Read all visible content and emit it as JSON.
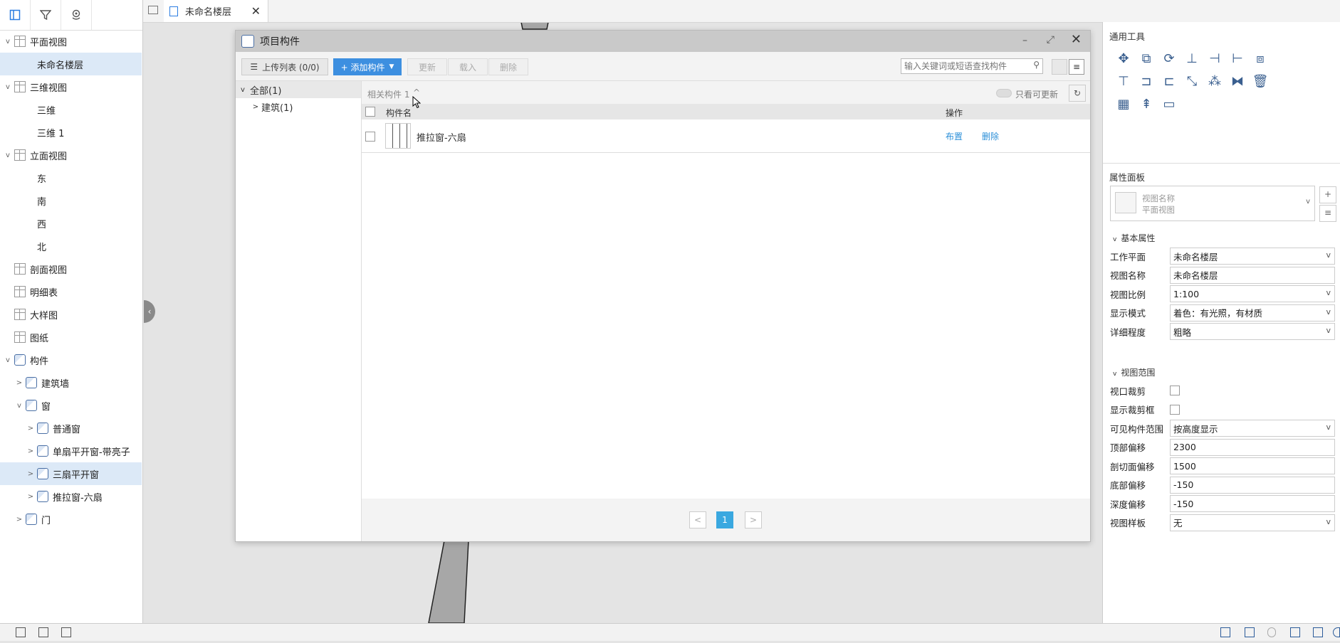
{
  "tab": {
    "title": "未命名楼层"
  },
  "tree": [
    {
      "label": "平面视图",
      "level": 0,
      "arrow": "v",
      "icon": "view"
    },
    {
      "label": "未命名楼层",
      "level": 1,
      "arrow": "",
      "icon": "",
      "selected": true
    },
    {
      "label": "三维视图",
      "level": 0,
      "arrow": "v",
      "icon": "view"
    },
    {
      "label": "三维",
      "level": 1,
      "arrow": "",
      "icon": ""
    },
    {
      "label": "三维 1",
      "level": 1,
      "arrow": "",
      "icon": ""
    },
    {
      "label": "立面视图",
      "level": 0,
      "arrow": "v",
      "icon": "view"
    },
    {
      "label": "东",
      "level": 1,
      "arrow": "",
      "icon": ""
    },
    {
      "label": "南",
      "level": 1,
      "arrow": "",
      "icon": ""
    },
    {
      "label": "西",
      "level": 1,
      "arrow": "",
      "icon": ""
    },
    {
      "label": "北",
      "level": 1,
      "arrow": "",
      "icon": ""
    },
    {
      "label": "剖面视图",
      "level": 0,
      "arrow": "",
      "icon": "view"
    },
    {
      "label": "明细表",
      "level": 0,
      "arrow": "",
      "icon": "view"
    },
    {
      "label": "大样图",
      "level": 0,
      "arrow": "",
      "icon": "view"
    },
    {
      "label": "图纸",
      "level": 0,
      "arrow": "",
      "icon": "view"
    },
    {
      "label": "构件",
      "level": 0,
      "arrow": "v",
      "icon": "comp"
    },
    {
      "label": "建筑墙",
      "level": 1,
      "arrow": ">",
      "icon": "comp"
    },
    {
      "label": "窗",
      "level": 1,
      "arrow": "v",
      "icon": "comp"
    },
    {
      "label": "普通窗",
      "level": 2,
      "arrow": ">",
      "icon": "comp"
    },
    {
      "label": "单扇平开窗-带亮子",
      "level": 2,
      "arrow": ">",
      "icon": "comp"
    },
    {
      "label": "三扇平开窗",
      "level": 2,
      "arrow": ">",
      "icon": "comp",
      "selected": true
    },
    {
      "label": "推拉窗-六扇",
      "level": 2,
      "arrow": ">",
      "icon": "comp"
    },
    {
      "label": "门",
      "level": 1,
      "arrow": ">",
      "icon": "comp"
    }
  ],
  "dialog": {
    "title": "项目构件",
    "upload_label": "上传列表 (0/0)",
    "add_label": "+ 添加构件",
    "update_label": "更新",
    "load_label": "载入",
    "delete_label": "删除",
    "search_placeholder": "输入关键词或短语查找构件",
    "tree_all": "全部(1)",
    "tree_building": "建筑(1)",
    "related_label": "相关构件 1",
    "only_updatable": "只看可更新",
    "col_name": "构件名",
    "col_action": "操作",
    "rows": [
      {
        "name": "推拉窗-六扇",
        "place": "布置",
        "delete": "删除"
      }
    ],
    "page": "1"
  },
  "right": {
    "tools_title": "通用工具",
    "props_title": "属性面板",
    "view_name_label": "视图名称",
    "view_name_value": "平面视图",
    "basic_section": "基本属性",
    "range_section": "视图范围",
    "props": [
      {
        "label": "工作平面",
        "value": "未命名楼层",
        "type": "select"
      },
      {
        "label": "视图名称",
        "value": "未命名楼层",
        "type": "text"
      },
      {
        "label": "视图比例",
        "value": "1:100",
        "type": "select"
      },
      {
        "label": "显示模式",
        "value": "着色：有光照，有材质",
        "type": "select"
      },
      {
        "label": "详细程度",
        "value": "粗略",
        "type": "select"
      }
    ],
    "range_props": [
      {
        "label": "视口裁剪",
        "value": "",
        "type": "check"
      },
      {
        "label": "显示裁剪框",
        "value": "",
        "type": "check"
      },
      {
        "label": "可见构件范围",
        "value": "按高度显示",
        "type": "select"
      },
      {
        "label": "顶部偏移",
        "value": "2300",
        "type": "text"
      },
      {
        "label": "剖切面偏移",
        "value": "1500",
        "type": "text"
      },
      {
        "label": "底部偏移",
        "value": "-150",
        "type": "text"
      },
      {
        "label": "深度偏移",
        "value": "-150",
        "type": "text"
      },
      {
        "label": "视图样板",
        "value": "无",
        "type": "select"
      }
    ]
  }
}
